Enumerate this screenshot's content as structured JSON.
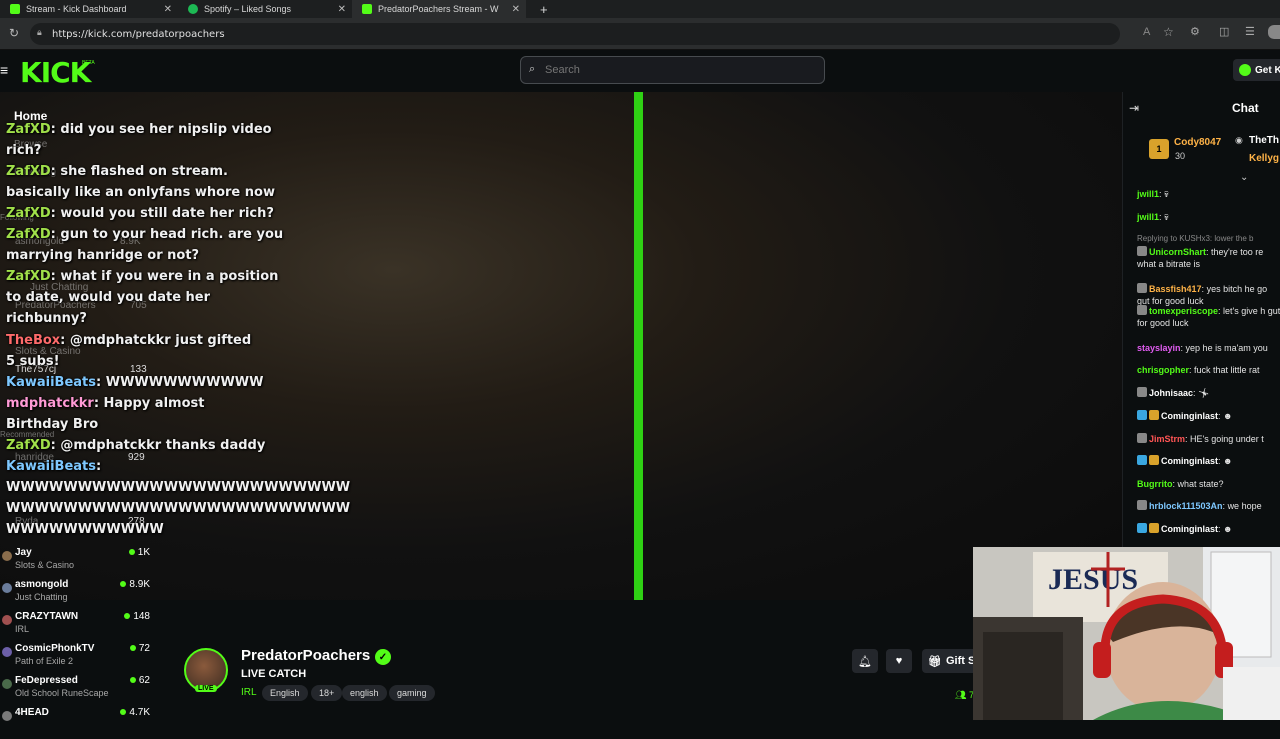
{
  "browser": {
    "tabs": [
      {
        "label": "Stream - Kick Dashboard",
        "color": "#53fc18"
      },
      {
        "label": "Spotify – Liked Songs",
        "color": "#1db954"
      },
      {
        "label": "PredatorPoachers Stream - W",
        "color": "#53fc18"
      }
    ],
    "new_tab": "+",
    "url": "https://kick.com/predatorpoachers"
  },
  "header": {
    "logo": "KICK",
    "logo_beta": "BETA",
    "search_placeholder": "Search",
    "get_kick_label": "Get K"
  },
  "sidebar": {
    "home": "Home",
    "browse": "Browse",
    "following": "Following",
    "following_section": "Following",
    "recommended_section": "Recommended",
    "channels": [
      {
        "name": "Jay",
        "category": "Slots & Casino",
        "viewers": "1K"
      },
      {
        "name": "asmongold",
        "category": "Just Chatting",
        "viewers": "8.9K"
      },
      {
        "name": "CRAZYTAWN",
        "category": "IRL",
        "viewers": "148"
      },
      {
        "name": "CosmicPhonkTV",
        "category": "Path of Exile 2",
        "viewers": "72"
      },
      {
        "name": "FeDepressed",
        "category": "Old School RuneScape",
        "viewers": "62"
      },
      {
        "name": "4HEAD",
        "category": "",
        "viewers": "4.7K"
      }
    ],
    "ghost_channels": [
      {
        "name": "asmongold",
        "category": "Just Chatting",
        "viewers": "8.9K"
      },
      {
        "name": "hanridge",
        "category": "",
        "viewers": "929"
      },
      {
        "name": "PredatorPoachers",
        "category": "",
        "viewers": "705"
      },
      {
        "name": "TheBox",
        "category": "Slots & Casino",
        "viewers": ""
      },
      {
        "name": "The757cj",
        "category": "",
        "viewers": "133"
      },
      {
        "name": "hanridge",
        "category": "",
        "viewers": "929"
      },
      {
        "name": "Ryda",
        "category": "",
        "viewers": "278"
      }
    ]
  },
  "overlay_chat": [
    {
      "user": "ZafXD",
      "text": "did you see her nipslip video",
      "wrap": "rich?"
    },
    {
      "user": "ZafXD",
      "text": "she flashed on stream.",
      "wrap": "basically like an onlyfans whore now"
    },
    {
      "user": "ZafXD",
      "text": "would you still date her rich?",
      "wrap": ""
    },
    {
      "user": "ZafXD",
      "text": "gun to your head rich. are you",
      "wrap": "marrying hanridge or not?"
    },
    {
      "user": "ZafXD",
      "text": "what if you were in a position",
      "wrap": "to date, would you date her"
    },
    {
      "user": "",
      "text": "richbunny?",
      "wrap": ""
    },
    {
      "user": "TheBox",
      "text": "@mdphatckkr just gifted",
      "wrap": "5 subs!"
    },
    {
      "user": "KawaiiBeats",
      "text": "WWWWWWWWWWW",
      "wrap": ""
    },
    {
      "user": "mdphatckkr",
      "text": "Happy almost",
      "wrap": "Birthday Bro"
    },
    {
      "user": "ZafXD",
      "text": "@mdphatckkr thanks daddy",
      "wrap": ""
    },
    {
      "user": "KawaiiBeats",
      "text": "",
      "wrap": "WWWWWWWWWWWWWWWWWWWWWWWW"
    },
    {
      "user": "",
      "text": "WWWWWWWWWWWWWWWWWWWWWWWW",
      "wrap": "WWWWWWWWWWW"
    }
  ],
  "stream": {
    "streamer": "PredatorPoachers",
    "live": "LIVE",
    "title": "LIVE CATCH",
    "category": "IRL",
    "tags": [
      "English",
      "18+",
      "english",
      "gaming"
    ],
    "gift_label": "Gift S",
    "viewer_count": "7"
  },
  "chat": {
    "title": "Chat",
    "pinned": [
      {
        "rank": "1",
        "name": "Cody8047",
        "count": "30"
      },
      {
        "name": "TheTh"
      },
      {
        "name": "Kellyg"
      }
    ],
    "messages": [
      {
        "user": "jwill1",
        "text": "",
        "color": "#53fc18"
      },
      {
        "user": "jwill1",
        "text": "",
        "color": "#53fc18"
      },
      {
        "user": "",
        "text": "Replying to KUSHx3: lower the b",
        "color": "#888888"
      },
      {
        "user": "UnicornShart",
        "text": "they're too re what a bitrate is",
        "color": "#53fc18"
      },
      {
        "user": "Bassfish417",
        "text": "yes bitch he go gut for good luck",
        "color": "#ffb347"
      },
      {
        "user": "tomexperiscope",
        "text": "let's give h gut for good luck",
        "color": "#53fc18"
      },
      {
        "user": "stayslayin",
        "text": "yep he is ma'am you",
        "color": "#e05cf0"
      },
      {
        "user": "chrisgopher",
        "text": "fuck that little rat",
        "color": "#53fc18"
      },
      {
        "user": "Johnisaac",
        "text": "",
        "color": "#ffffff"
      },
      {
        "user": "Comingin​last",
        "text": "",
        "color": "#ffffff"
      },
      {
        "user": "JimStrm",
        "text": "HE's going under t",
        "color": "#ff5555"
      },
      {
        "user": "Comingin​last",
        "text": "",
        "color": "#ffffff"
      },
      {
        "user": "Bugrrito",
        "text": "what state?",
        "color": "#53fc18"
      },
      {
        "user": "hrblock111503An",
        "text": "we hope",
        "color": "#7ec8ff"
      },
      {
        "user": "Comingin​last",
        "text": "",
        "color": "#ffffff"
      }
    ]
  },
  "colors": {
    "accent": "#53fc18",
    "bg": "#0b0e0f"
  }
}
